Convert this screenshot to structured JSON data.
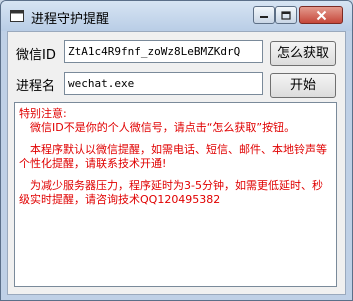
{
  "window": {
    "title": "进程守护提醒"
  },
  "form": {
    "wechat_id_label": "微信ID",
    "wechat_id_value": "ZtA1c4R9fnf_zoWz8LeBMZKdrQ",
    "get_button": "怎么获取",
    "process_label": "进程名",
    "process_value": "wechat.exe",
    "start_button": "开始"
  },
  "notice": {
    "heading": "特别注意:",
    "line1": "　微信ID不是你的个人微信号，请点击“怎么获取”按钮。",
    "line2": "　本程序默认以微信提醒，如需电话、短信、邮件、本地铃声等个性化提醒，请联系技术开通!",
    "line3": "　为减少服务器压力，程序延时为3-5分钟，如需更低延时、秒级实时提醒，请咨询技术QQ120495382"
  },
  "colors": {
    "notice_text": "#e00000",
    "window_frame": "#bfd0e6",
    "close_button": "#c5473a"
  }
}
